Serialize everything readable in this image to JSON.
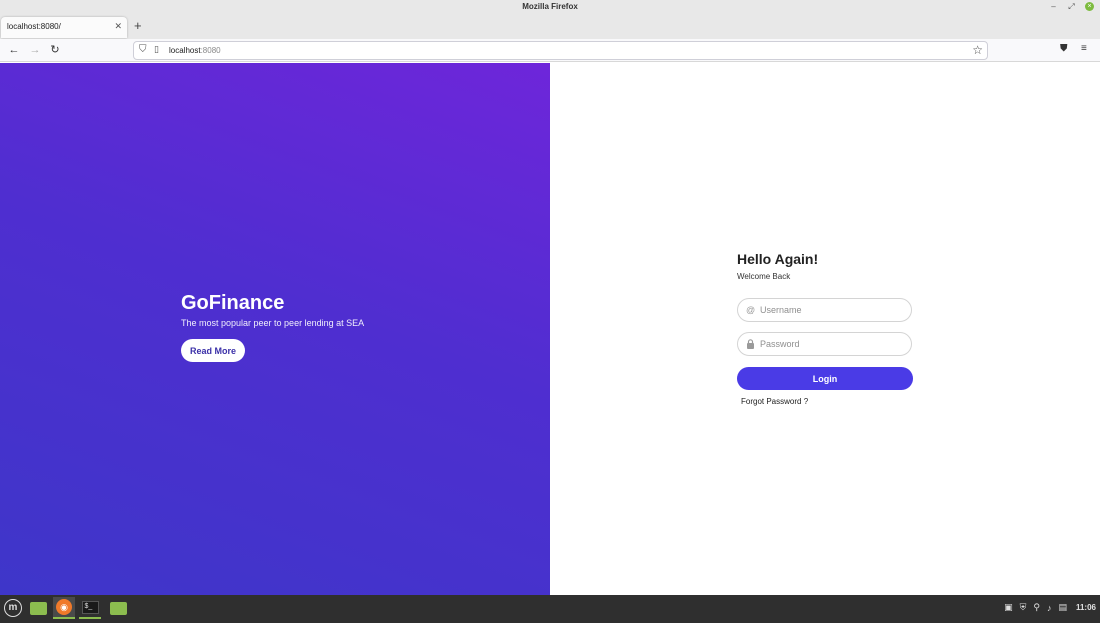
{
  "window": {
    "title": "Mozilla Firefox"
  },
  "tabs": [
    {
      "label": "localhost:8080/"
    }
  ],
  "urlbar": {
    "host": "localhost",
    "port": ":8080"
  },
  "hero": {
    "brand": "GoFinance",
    "tagline": "The most popular peer to peer lending at SEA",
    "read_more": "Read More",
    "gradient_start": "#6e26da",
    "gradient_end": "#3e36c9"
  },
  "login": {
    "greeting": "Hello Again!",
    "welcome": "Welcome Back",
    "username_placeholder": "Username",
    "password_placeholder": "Password",
    "login_label": "Login",
    "forgot_label": "Forgot Password ?",
    "accent": "#4a3be6"
  },
  "taskbar": {
    "apps": [
      "menu-icon",
      "files-icon",
      "firefox-icon",
      "terminal-icon",
      "files-icon"
    ],
    "clock": "11:06"
  }
}
